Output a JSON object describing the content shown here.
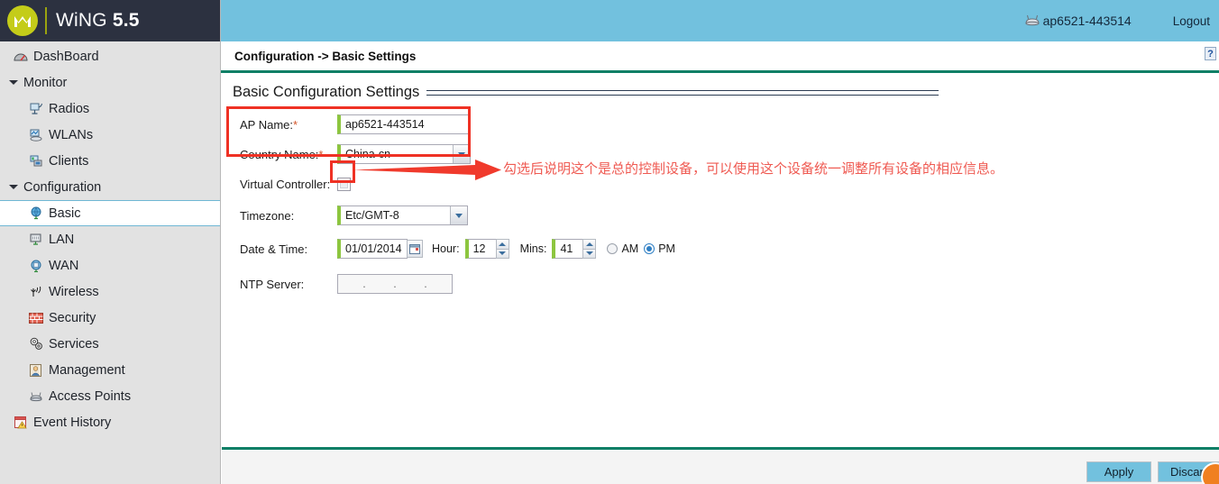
{
  "brand": {
    "logo_icon": "motorola-logo-icon",
    "name_light": "WiNG ",
    "name_bold": "5.5",
    "name_full": "WiNG 5.5"
  },
  "topbar": {
    "device_icon": "access-point-icon",
    "device_name": "ap6521-443514",
    "logout_label": "Logout"
  },
  "breadcrumb": {
    "text": "Configuration -> Basic Settings",
    "help_label": "?"
  },
  "sidebar": {
    "items": [
      {
        "label": "DashBoard",
        "icon": "dashboard-icon",
        "level": "root-leaf",
        "selected": false
      },
      {
        "label": "Monitor",
        "icon": "triangle-down-icon",
        "level": "group",
        "selected": false
      },
      {
        "label": "Radios",
        "icon": "radios-icon",
        "level": "child",
        "selected": false
      },
      {
        "label": "WLANs",
        "icon": "wlans-icon",
        "level": "child",
        "selected": false
      },
      {
        "label": "Clients",
        "icon": "clients-icon",
        "level": "child",
        "selected": false
      },
      {
        "label": "Configuration",
        "icon": "triangle-down-icon",
        "level": "group",
        "selected": false
      },
      {
        "label": "Basic",
        "icon": "globe-icon",
        "level": "child",
        "selected": true
      },
      {
        "label": "LAN",
        "icon": "lan-icon",
        "level": "child",
        "selected": false
      },
      {
        "label": "WAN",
        "icon": "wan-icon",
        "level": "child",
        "selected": false
      },
      {
        "label": "Wireless",
        "icon": "wireless-icon",
        "level": "child",
        "selected": false
      },
      {
        "label": "Security",
        "icon": "firewall-icon",
        "level": "child",
        "selected": false
      },
      {
        "label": "Services",
        "icon": "gears-icon",
        "level": "child",
        "selected": false
      },
      {
        "label": "Management",
        "icon": "management-icon",
        "level": "child",
        "selected": false
      },
      {
        "label": "Access Points",
        "icon": "access-point-icon",
        "level": "child",
        "selected": false
      },
      {
        "label": "Event History",
        "icon": "event-history-icon",
        "level": "root-leaf",
        "selected": false
      }
    ]
  },
  "panel": {
    "title": "Basic Configuration Settings"
  },
  "form": {
    "ap_name": {
      "label": "AP Name:",
      "required_marker": "*",
      "value": "ap6521-443514"
    },
    "country_name": {
      "label": "Country Name:",
      "required_marker": "*",
      "value": "China-cn"
    },
    "virtual_controller": {
      "label": "Virtual Controller:",
      "checked": false
    },
    "timezone": {
      "label": "Timezone:",
      "value": "Etc/GMT-8"
    },
    "date_time": {
      "label": "Date & Time:",
      "date_value": "01/01/2014",
      "calendar_icon": "calendar-icon",
      "hour_label": "Hour:",
      "hour_value": "12",
      "mins_label": "Mins:",
      "mins_value": "41",
      "am_label": "AM",
      "pm_label": "PM",
      "meridiem_selected": "PM"
    },
    "ntp_server": {
      "label": "NTP Server:",
      "octet_separator": ".",
      "value": ""
    }
  },
  "annotations": {
    "note_text": "勾选后说明这个是总的控制设备，可以使用这个设备统一调整所有设备的相应信息。",
    "highlight_color": "#ef3124",
    "note_color": "#ef5a52"
  },
  "footer": {
    "apply_label": "Apply",
    "discard_label": "Discard"
  },
  "colors": {
    "brand_bar": "#2c3140",
    "accent_blue": "#72c1de",
    "accent_green": "#0d7f66",
    "logo_green": "#c4cc19",
    "field_green": "#8dc63f",
    "sidebar_bg": "#e2e2e2"
  }
}
